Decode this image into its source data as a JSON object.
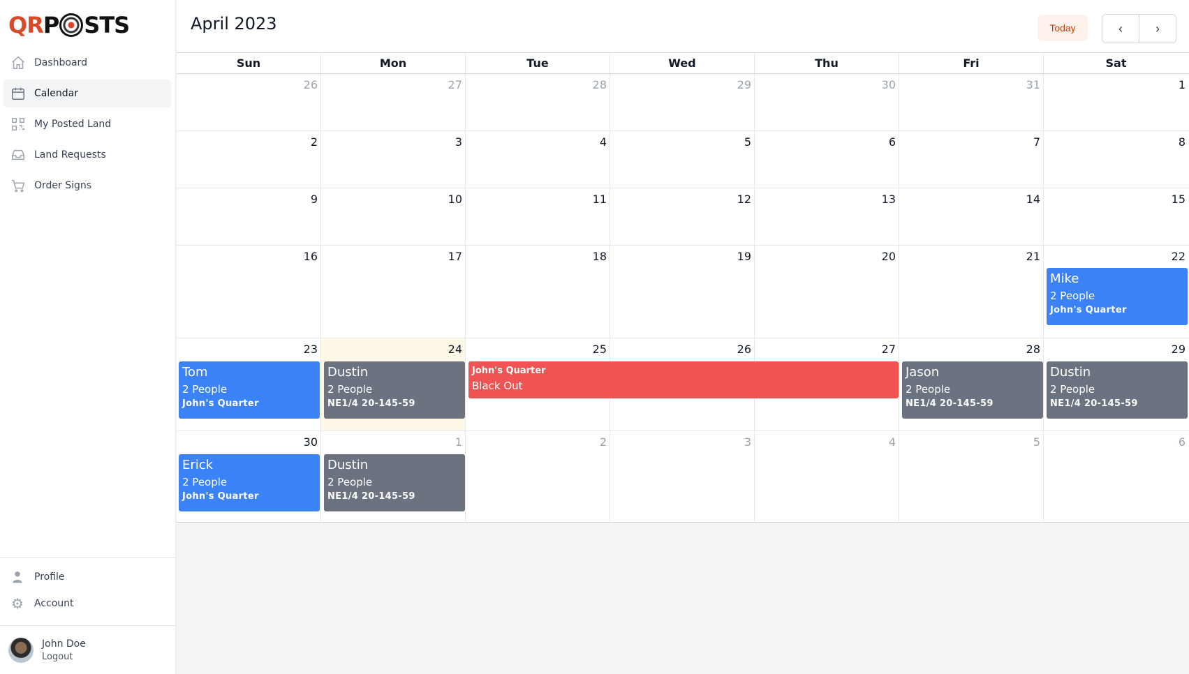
{
  "logo": {
    "left": "QR",
    "right": "STS",
    "mid": "PO"
  },
  "sidebar": {
    "items": [
      {
        "label": "Dashboard",
        "icon": "home-icon"
      },
      {
        "label": "Calendar",
        "icon": "calendar-icon"
      },
      {
        "label": "My Posted Land",
        "icon": "qr-code-icon"
      },
      {
        "label": "Land Requests",
        "icon": "inbox-icon"
      },
      {
        "label": "Order Signs",
        "icon": "cart-icon"
      }
    ],
    "bottom": [
      {
        "label": "Profile",
        "icon": "user-icon"
      },
      {
        "label": "Account",
        "icon": "gear-icon"
      }
    ],
    "user": {
      "name": "John Doe",
      "logout": "Logout"
    }
  },
  "header": {
    "title": "April 2023",
    "today": "Today",
    "prev": "‹",
    "next": "›"
  },
  "calendar": {
    "days_of_week": [
      "Sun",
      "Mon",
      "Tue",
      "Wed",
      "Thu",
      "Fri",
      "Sat"
    ],
    "weeks": [
      [
        "26",
        "27",
        "28",
        "29",
        "30",
        "31",
        "1"
      ],
      [
        "2",
        "3",
        "4",
        "5",
        "6",
        "7",
        "8"
      ],
      [
        "9",
        "10",
        "11",
        "12",
        "13",
        "14",
        "15"
      ],
      [
        "16",
        "17",
        "18",
        "19",
        "20",
        "21",
        "22"
      ],
      [
        "23",
        "24",
        "25",
        "26",
        "27",
        "28",
        "29"
      ],
      [
        "30",
        "1",
        "2",
        "3",
        "4",
        "5",
        "6"
      ]
    ],
    "events": [
      {
        "name": "Mike",
        "people": "2 People",
        "land": "John's Quarter",
        "color": "#3b82f6"
      },
      {
        "name": "Tom",
        "people": "2 People",
        "land": "John's Quarter",
        "color": "#3b82f6"
      },
      {
        "name": "Dustin",
        "people": "2 People",
        "land": "NE1/4 20-145-59",
        "color": "#6b7280"
      },
      {
        "land": "John's Quarter",
        "title": "Black Out",
        "color": "#ef5353"
      },
      {
        "name": "Jason",
        "people": "2 People",
        "land": "NE1/4 20-145-59",
        "color": "#6b7280"
      },
      {
        "name": "Dustin",
        "people": "2 People",
        "land": "NE1/4 20-145-59",
        "color": "#6b7280"
      },
      {
        "name": "Erick",
        "people": "2 People",
        "land": "John's Quarter",
        "color": "#3b82f6"
      },
      {
        "name": "Dustin",
        "people": "2 People",
        "land": "NE1/4 20-145-59",
        "color": "#6b7280"
      }
    ]
  }
}
